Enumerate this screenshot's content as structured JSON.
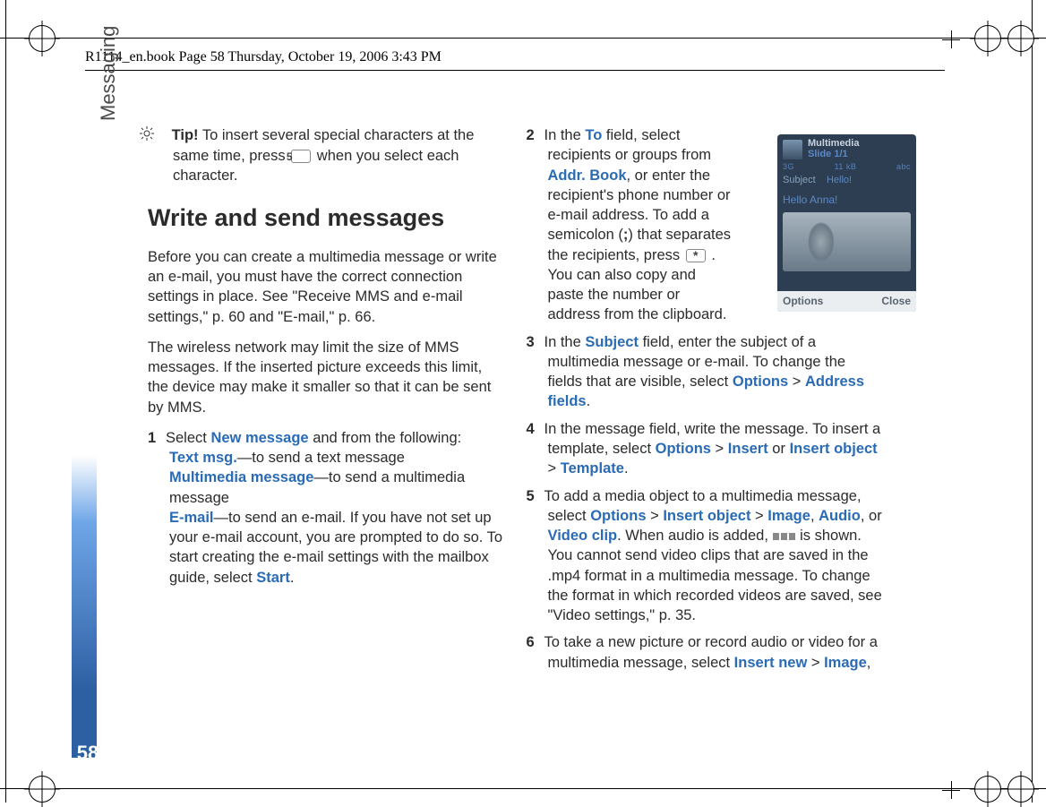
{
  "doc": {
    "header": "R1114_en.book  Page 58  Thursday, October 19, 2006  3:43 PM",
    "section_label": "Messaging",
    "page_number": "58",
    "tip_label": "Tip!",
    "tip_text": " To insert several special characters at the same time, press ",
    "tip_key": "5",
    "tip_text2": " when you select each character.",
    "heading": "Write and send messages",
    "para1": "Before you can create a multimedia message or write an e-mail, you must have the correct connection settings in place. See \"Receive MMS and e-mail settings,\" p. 60 and \"E-mail,\" p. 66.",
    "para2": "The wireless network may limit the size of MMS messages. If the inserted picture exceeds this limit, the device may make it smaller so that it can be sent by MMS.",
    "step1_num": "1",
    "step1_a": "Select ",
    "step1_b": " and from the following:",
    "step1_newmsg": "New message",
    "step1_text_msg": "Text msg.",
    "step1_text_msg_desc": "—to send a text message",
    "step1_mms": "Multimedia message",
    "step1_mms_desc": "—to send a multimedia message",
    "step1_email": "E-mail",
    "step1_email_desc": "—to send an e-mail. If you have not set up your e-mail account, you are prompted to do so. To start creating the e-mail settings with the mailbox guide, select ",
    "step1_start": "Start",
    "step2_num": "2",
    "step2_a": "In the ",
    "step2_to": "To",
    "step2_b": " field, select recipients or groups from ",
    "step2_addr": "Addr. Book",
    "step2_c": ", or enter the recipient's phone number or e-mail address. To add a semicolon (",
    "step2_semi": ";",
    "step2_d": ") that separates the recipients, press ",
    "step2_star": "*",
    "step2_e": " . You can also copy and paste the number or address from the clipboard.",
    "step3_num": "3",
    "step3_a": "In the ",
    "step3_subject": "Subject",
    "step3_b": " field, enter the subject of a multimedia message or e-mail. To change the fields that are visible, select ",
    "step3_options": "Options",
    "step3_c": " > ",
    "step3_addrfields": "Address fields",
    "step3_d": ".",
    "step4_num": "4",
    "step4_a": "In the message field, write the message. To insert a template, select ",
    "step4_options": "Options",
    "step4_b": " > ",
    "step4_insert": "Insert",
    "step4_c": " or ",
    "step4_insertobj": "Insert object",
    "step4_d": " > ",
    "step4_template": "Template",
    "step4_e": ".",
    "step5_num": "5",
    "step5_a": "To add a media object to a multimedia message, select ",
    "step5_options": "Options",
    "step5_b": " > ",
    "step5_insertobj": "Insert object",
    "step5_c": " > ",
    "step5_image": "Image",
    "step5_d": ", ",
    "step5_audio": "Audio",
    "step5_e": ", or ",
    "step5_video": "Video clip",
    "step5_f": ". When audio is added, ",
    "step5_g": " is shown.",
    "step5_h": "You cannot send video clips that are saved in the .mp4 format in a multimedia message. To change the format in which recorded videos are saved, see \"Video settings,\" p. 35.",
    "step6_num": "6",
    "step6_a": "To take a new picture or record audio or video for a multimedia message, select ",
    "step6_insertnew": "Insert new",
    "step6_b": " > ",
    "step6_image": "Image",
    "step6_c": ","
  },
  "phone": {
    "title1": "Multimedia",
    "title2": "Slide 1/1",
    "size": "11 kB",
    "net": "3G",
    "mode": "abc",
    "subject_label": "Subject",
    "subject_value": "Hello!",
    "message": "Hello Anna!",
    "left_softkey": "Options",
    "right_softkey": "Close"
  }
}
